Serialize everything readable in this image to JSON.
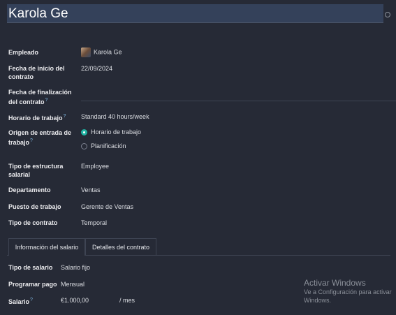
{
  "header": {
    "employee_name": "Karola Ge"
  },
  "fields": {
    "empleado": {
      "label": "Empleado",
      "value": "Karola Ge"
    },
    "fecha_inicio": {
      "label": "Fecha de inicio del contrato",
      "value": "22/09/2024"
    },
    "fecha_fin": {
      "label": "Fecha de finalización del contrato",
      "help": "?",
      "value": ""
    },
    "horario": {
      "label": "Horario de trabajo",
      "help": "?",
      "value": "Standard 40 hours/week"
    },
    "origen": {
      "label": "Origen de entrada de trabajo",
      "help": "?",
      "options": [
        "Horario de trabajo",
        "Planificación"
      ],
      "selected": "Horario de trabajo"
    },
    "estructura": {
      "label": "Tipo de estructura salarial",
      "value": "Employee"
    },
    "departamento": {
      "label": "Departamento",
      "value": "Ventas"
    },
    "puesto": {
      "label": "Puesto de trabajo",
      "value": "Gerente de Ventas"
    },
    "tipo_contrato": {
      "label": "Tipo de contrato",
      "value": "Temporal"
    }
  },
  "tabs": [
    "Información del salario",
    "Detalles del contrato"
  ],
  "salary": {
    "tipo": {
      "label": "Tipo de salario",
      "value": "Salario fijo"
    },
    "programar": {
      "label": "Programar pago",
      "value": "Mensual"
    },
    "salario": {
      "label": "Salario",
      "help": "?",
      "value": "€1.000,00",
      "unit": "/ mes"
    }
  },
  "watermark": {
    "title": "Activar Windows",
    "subtitle_line1": "Ve a Configuración para activar",
    "subtitle_line2": "Windows."
  }
}
